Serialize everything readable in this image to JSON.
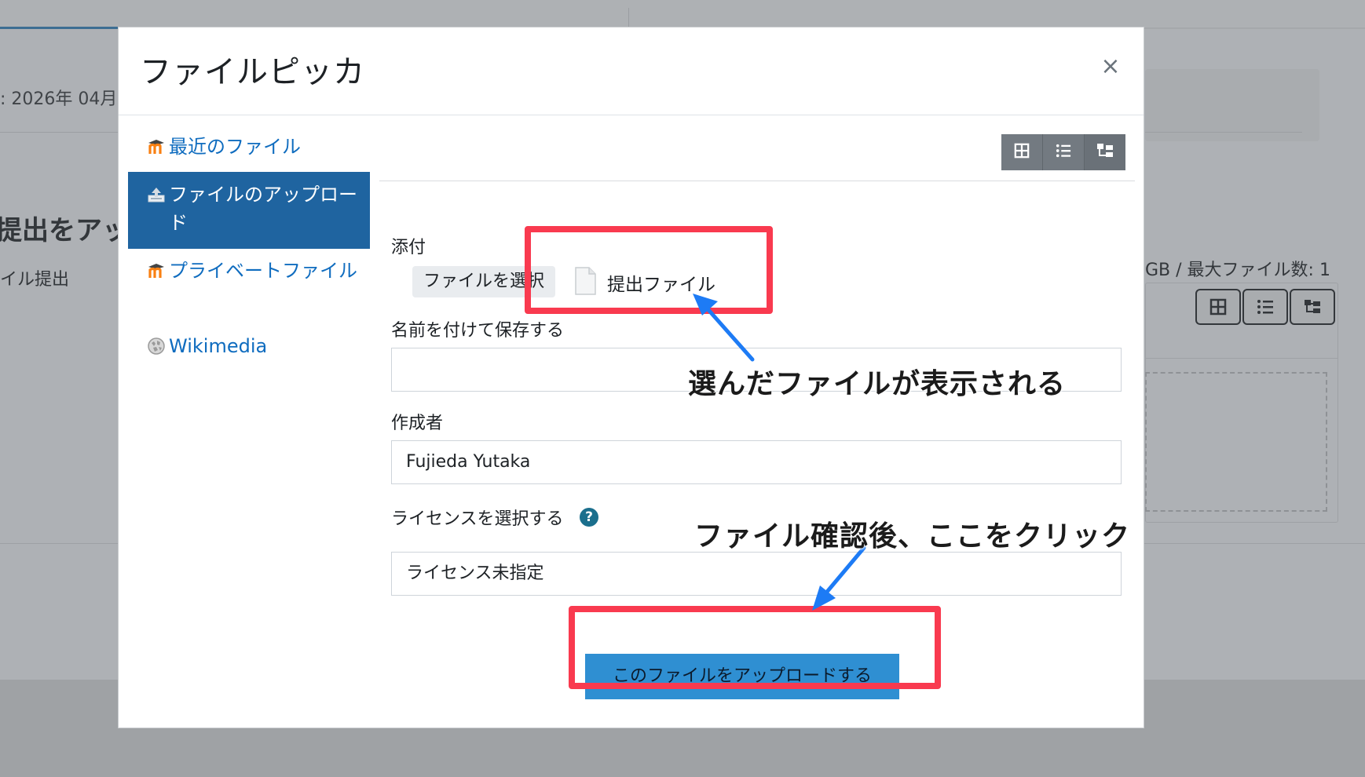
{
  "background": {
    "date_text": ": 2026年 04月",
    "heading": "提出をアッ",
    "sub_text": "イル提出",
    "limits_text": "GB / 最大ファイル数: 1"
  },
  "modal": {
    "title": "ファイルピッカ",
    "close_label": "×"
  },
  "sidebar": {
    "items": [
      {
        "label": "最近のファイル",
        "icon": "moodle-icon",
        "active": false
      },
      {
        "label": "ファイルのアップロード",
        "icon": "upload-icon",
        "active": true
      },
      {
        "label": "プライベートファイル",
        "icon": "moodle-icon",
        "active": false
      },
      {
        "label": "Wikimedia",
        "icon": "wikimedia-icon",
        "active": false
      }
    ]
  },
  "viewbar": {
    "buttons": [
      "grid-view-icon",
      "list-view-icon",
      "tree-view-icon"
    ]
  },
  "form": {
    "attachment_label": "添付",
    "choose_file_label": "ファイルを選択",
    "selected_file_name": "提出ファイル",
    "saveas_label": "名前を付けて保存する",
    "saveas_value": "",
    "author_label": "作成者",
    "author_value": "Fujieda Yutaka",
    "license_label": "ライセンスを選択する",
    "license_value": "ライセンス未指定",
    "help_label": "?",
    "upload_button_label": "このファイルをアップロードする"
  },
  "annotations": {
    "file_shown_text": "選んだファイルが表示される",
    "click_here_text": "ファイル確認後、ここをクリック",
    "highlight_color": "#f93a4f",
    "arrow_color": "#1d7bf5"
  }
}
